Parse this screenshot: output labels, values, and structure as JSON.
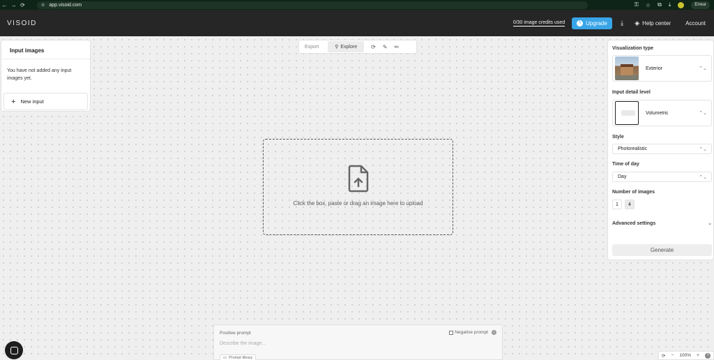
{
  "browser": {
    "url": "app.visoid.com",
    "profile_label": "Erreur"
  },
  "header": {
    "logo": "VISOID",
    "credits": "0/30 image credits used",
    "upgrade_label": "Upgrade",
    "help_label": "Help center",
    "account_label": "Account",
    "accent_color": "#39a5e8"
  },
  "input_panel": {
    "title": "Input images",
    "empty_text": "You have not added any input images yet.",
    "new_input_label": "New input"
  },
  "toolbar": {
    "export_label": "Export",
    "explore_label": "Explore"
  },
  "upload": {
    "text": "Click the box, paste or drag an image here to upload"
  },
  "settings": {
    "viz_type_label": "Visualization type",
    "viz_type_value": "Exterior",
    "detail_label": "Input detail level",
    "detail_value": "Volumetric",
    "style_label": "Style",
    "style_value": "Photorealistic",
    "time_label": "Time of day",
    "time_value": "Day",
    "num_images_label": "Number of images",
    "num_options": [
      "1",
      "4"
    ],
    "num_selected": "4",
    "advanced_label": "Advanced settings",
    "generate_label": "Generate"
  },
  "prompt": {
    "positive_label": "Positive prompt",
    "negative_label": "Negative prompt",
    "placeholder": "Describe the image...",
    "library_label": "Prompt library"
  },
  "zoom": {
    "level": "100%"
  }
}
